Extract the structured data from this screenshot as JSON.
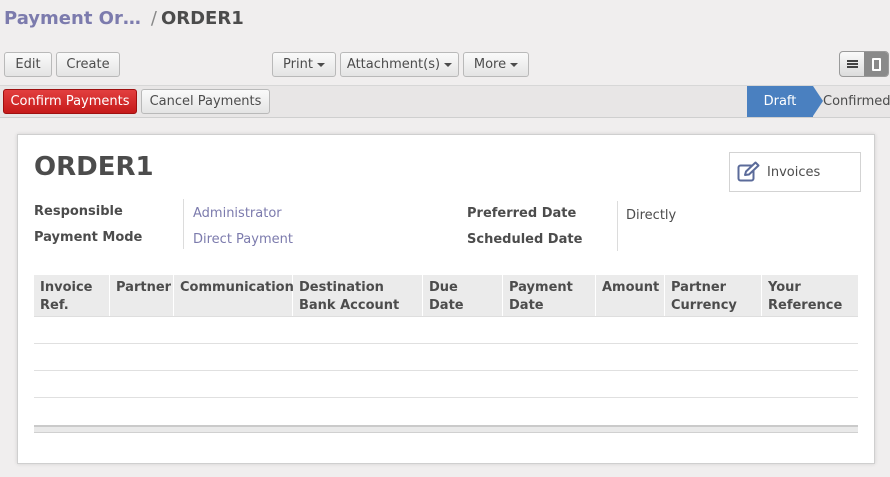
{
  "breadcrumb": {
    "parent": "Payment Or…",
    "separator": "/",
    "current": "ORDER1"
  },
  "toolbar": {
    "edit": "Edit",
    "create": "Create",
    "print": "Print",
    "attachments": "Attachment(s)",
    "more": "More"
  },
  "view_switch": {
    "list_icon": "list-icon",
    "form_icon": "form-icon",
    "active": "form"
  },
  "statusbar": {
    "confirm": "Confirm Payments",
    "cancel": "Cancel Payments",
    "stages": [
      "Draft",
      "Confirmed"
    ],
    "active_stage": "Draft"
  },
  "record": {
    "title": "ORDER1",
    "smart_button": {
      "label": "Invoices",
      "icon": "edit-icon"
    },
    "fields": {
      "responsible_label": "Responsible",
      "responsible_value": "Administrator",
      "payment_mode_label": "Payment Mode",
      "payment_mode_value": "Direct Payment",
      "preferred_date_label": "Preferred Date",
      "preferred_date_value": "Directly",
      "scheduled_date_label": "Scheduled Date",
      "scheduled_date_value": ""
    }
  },
  "lines_table": {
    "columns": [
      "Invoice Ref.",
      "Partner",
      "Communication",
      "Destination Bank Account",
      "Due Date",
      "Payment Date",
      "Amount",
      "Partner Currency",
      "Your Reference"
    ],
    "rows": []
  },
  "colors": {
    "link": "#7c7bad",
    "primary_button": "#c61a1a",
    "stage_active": "#4a80c0"
  }
}
